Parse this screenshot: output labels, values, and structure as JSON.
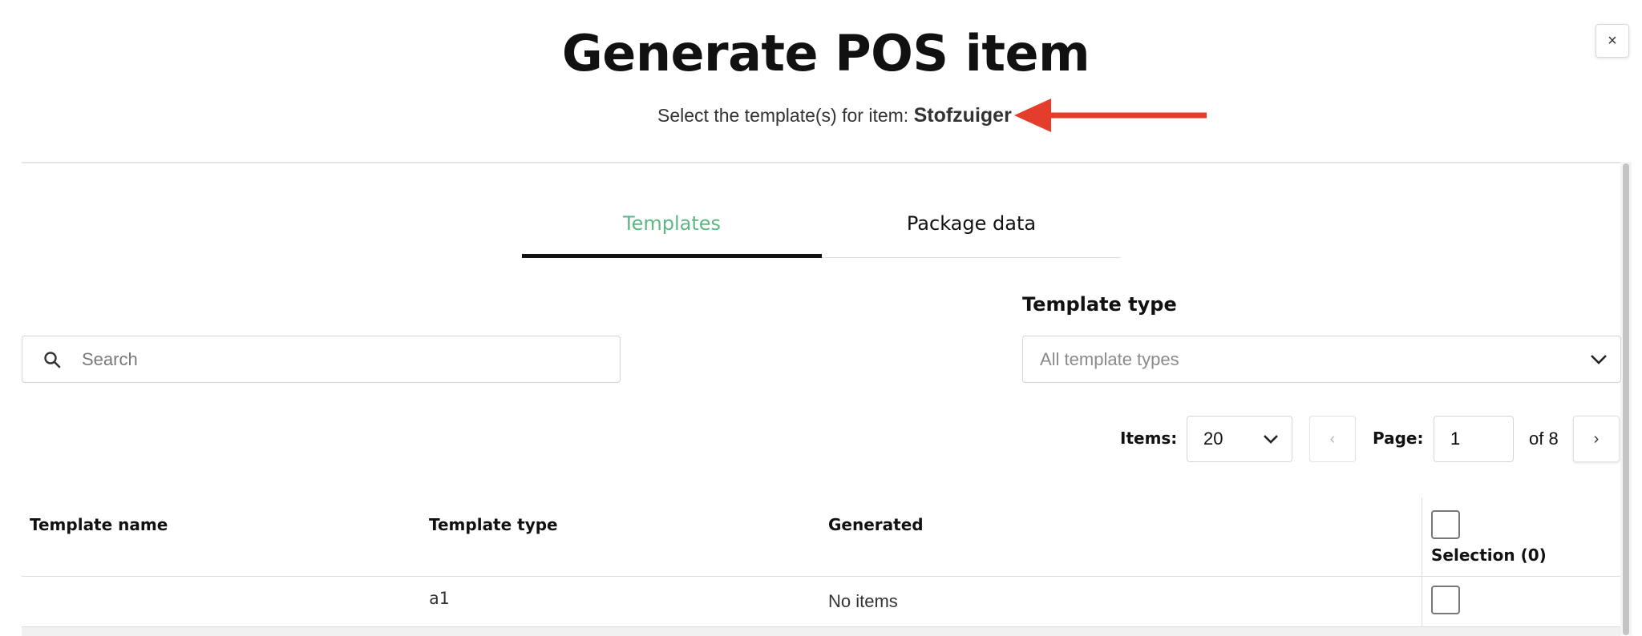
{
  "dialog": {
    "title": "Generate POS item",
    "subtitle_prefix": "Select the template(s) for item:",
    "item_name": "Stofzuiger",
    "close_label": "×"
  },
  "annotation": {
    "arrow_color": "#e43d2b"
  },
  "tabs": [
    {
      "label": "Templates",
      "active": true,
      "color": "#5db783"
    },
    {
      "label": "Package data",
      "active": false
    }
  ],
  "search": {
    "placeholder": "Search",
    "value": ""
  },
  "template_type": {
    "label": "Template type",
    "selected": "All template types"
  },
  "pagination": {
    "items_label": "Items:",
    "items_per_page": "20",
    "prev_label": "‹",
    "page_label": "Page:",
    "page_value": "1",
    "of_label": "of 8",
    "next_label": "›"
  },
  "table": {
    "columns": [
      "Template name",
      "Template type",
      "Generated",
      "Selection (0)"
    ],
    "rows": [
      {
        "name": "",
        "type": "a1",
        "generated": "No items",
        "selected": false
      }
    ]
  }
}
